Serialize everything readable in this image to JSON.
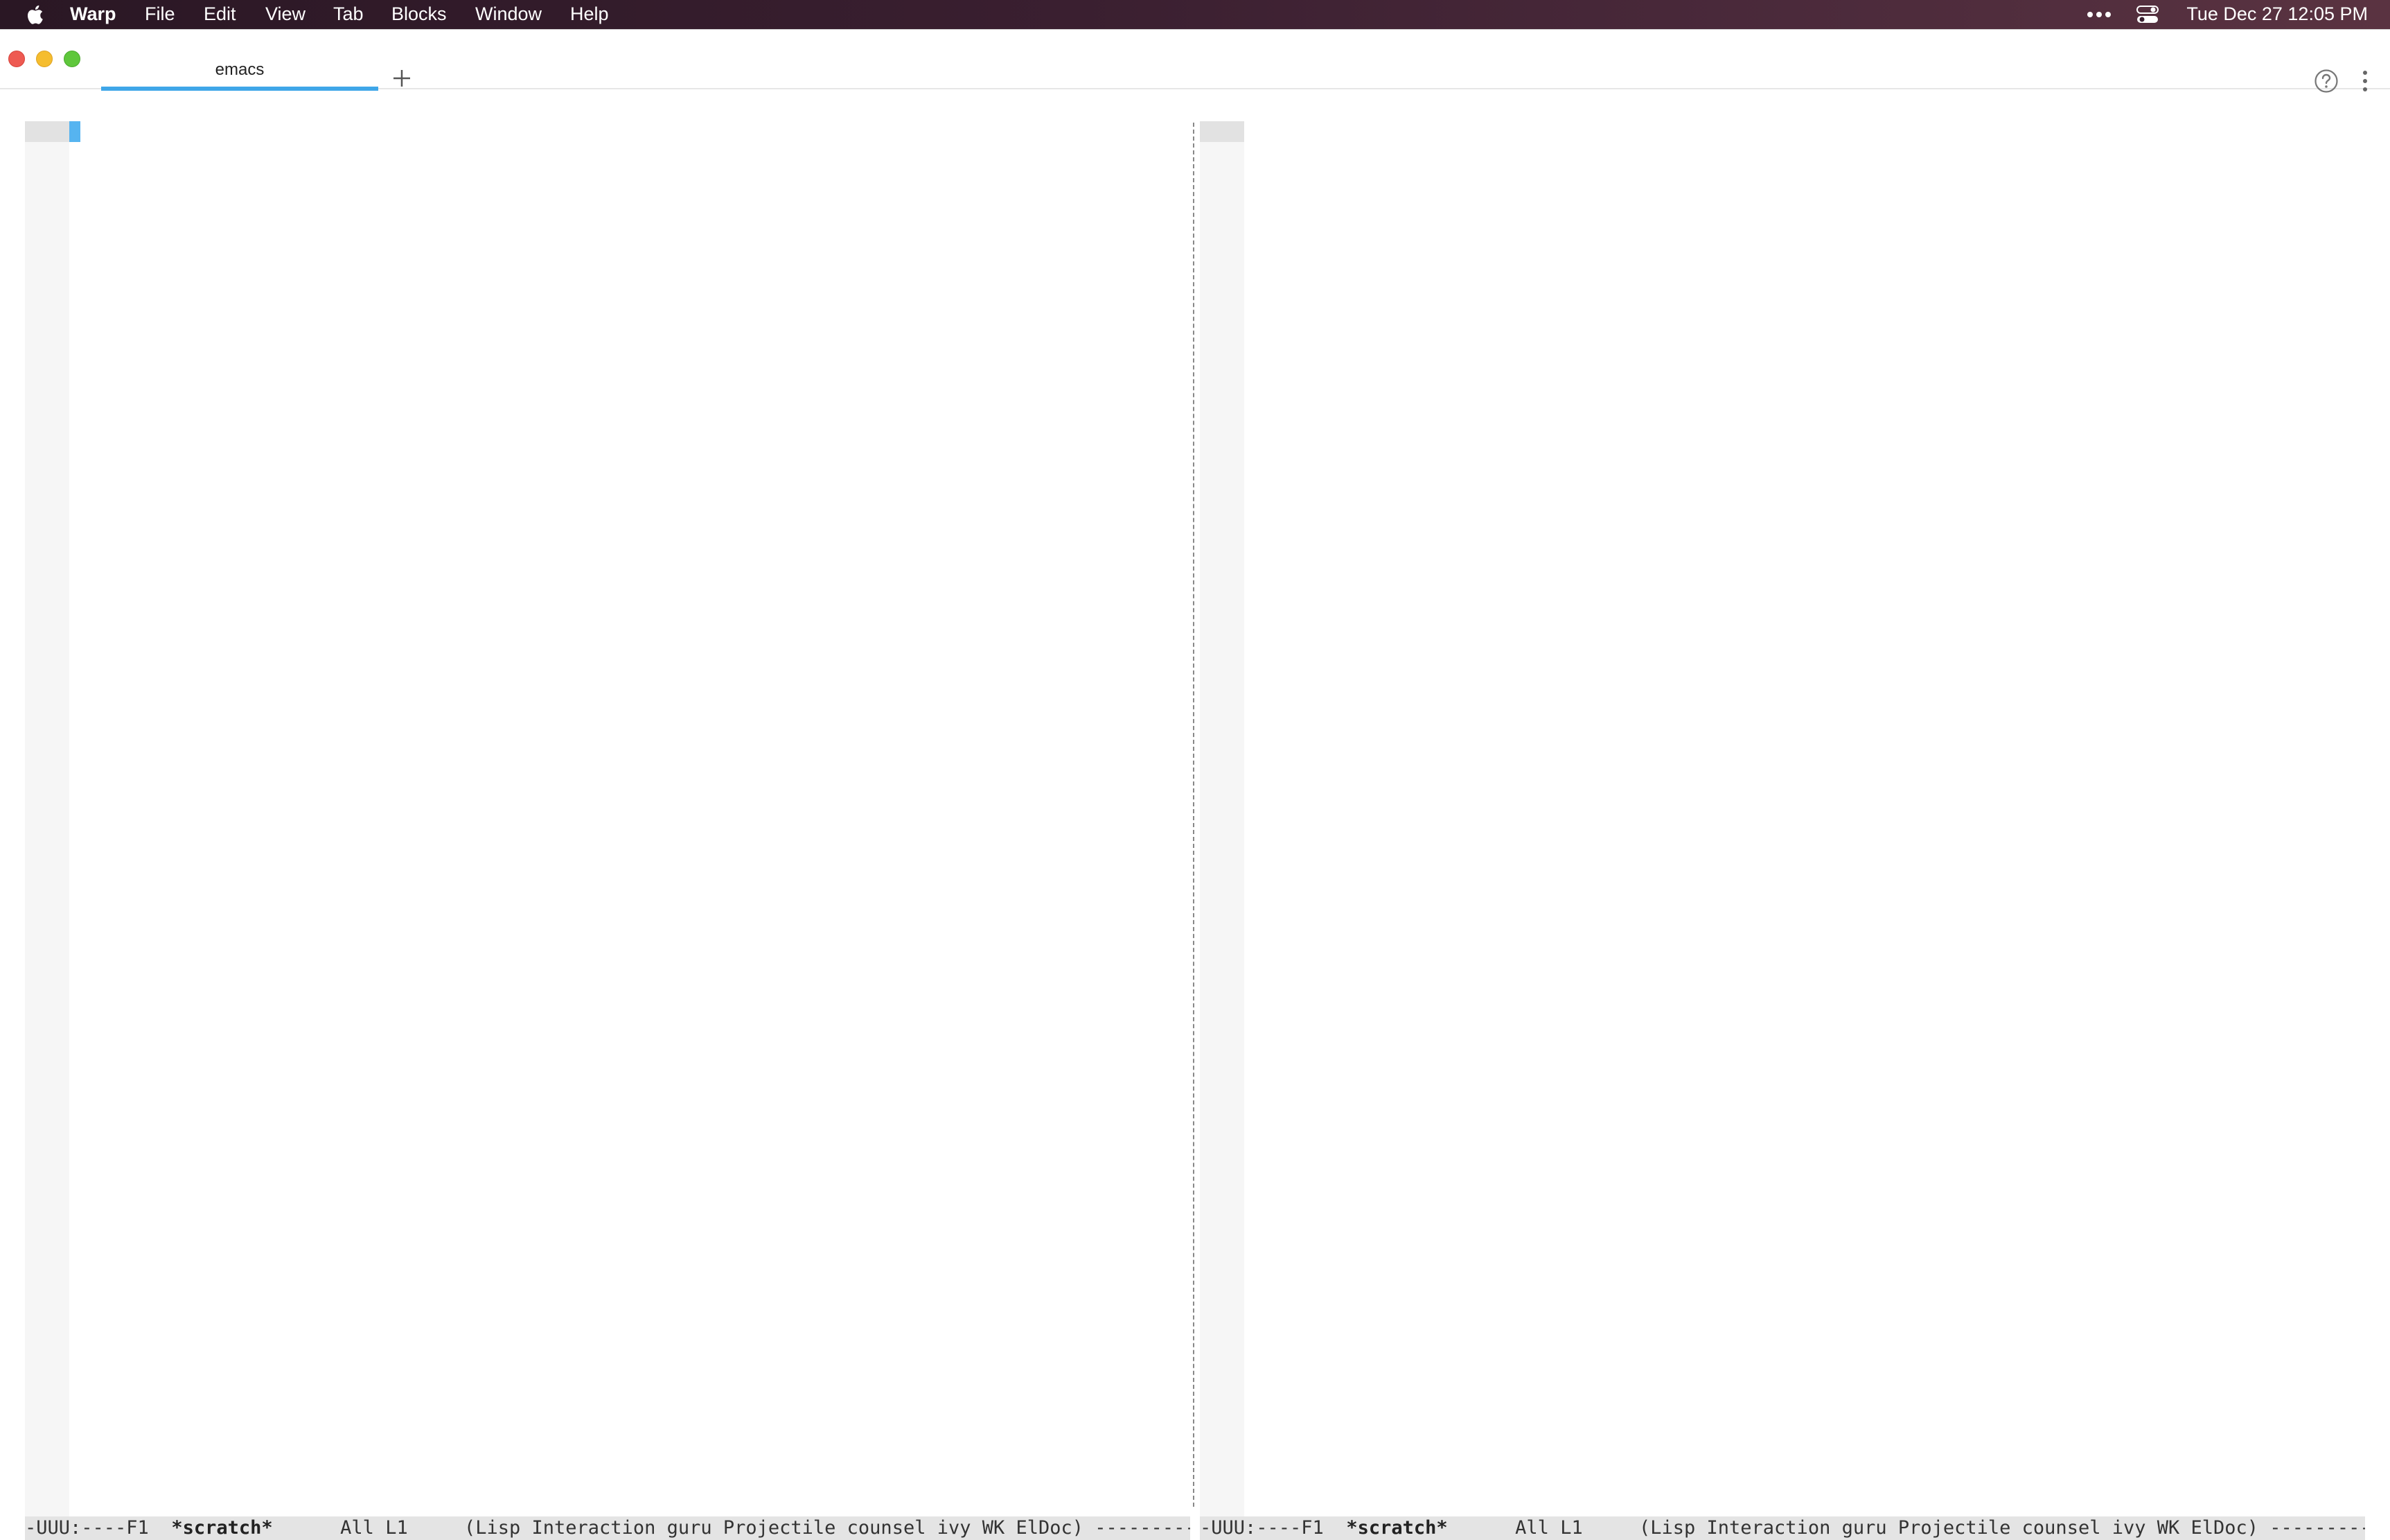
{
  "menubar": {
    "apple_icon": "apple-icon",
    "app_name": "Warp",
    "items": [
      "File",
      "Edit",
      "View",
      "Tab",
      "Blocks",
      "Window",
      "Help"
    ],
    "status_icons": [
      "more-icon",
      "control-center-icon"
    ],
    "clock": "Tue Dec 27  12:05 PM"
  },
  "window": {
    "tabs": [
      {
        "label": "emacs",
        "active": true
      }
    ],
    "new_tab_icon": "plus-icon",
    "help_icon": "help-icon",
    "menu_icon": "kebab-icon"
  },
  "panes": [
    {
      "id": "left",
      "modeline": {
        "prefix": "-UUU:----F1  ",
        "buffer": "*scratch*",
        "position": "      All L1     ",
        "modes": "(Lisp Interaction guru Projectile counsel ivy WK ElDoc) ----------"
      },
      "has_cursor": true
    },
    {
      "id": "right",
      "modeline": {
        "prefix": "-UUU:----F1  ",
        "buffer": "*scratch*",
        "position": "      All L1     ",
        "modes": "(Lisp Interaction guru Projectile counsel ivy WK ElDoc) ----------"
      },
      "has_cursor": false
    }
  ],
  "colors": {
    "menubar_bg": "#3a1f30",
    "tab_accent": "#3fa6e8",
    "cursor": "#56b4f0",
    "modeline_bg": "#e4e4e4",
    "fringe": "#f6f6f6",
    "close": "#ee5a52",
    "minimize": "#f5bd2f",
    "maximize": "#5fc73c"
  }
}
